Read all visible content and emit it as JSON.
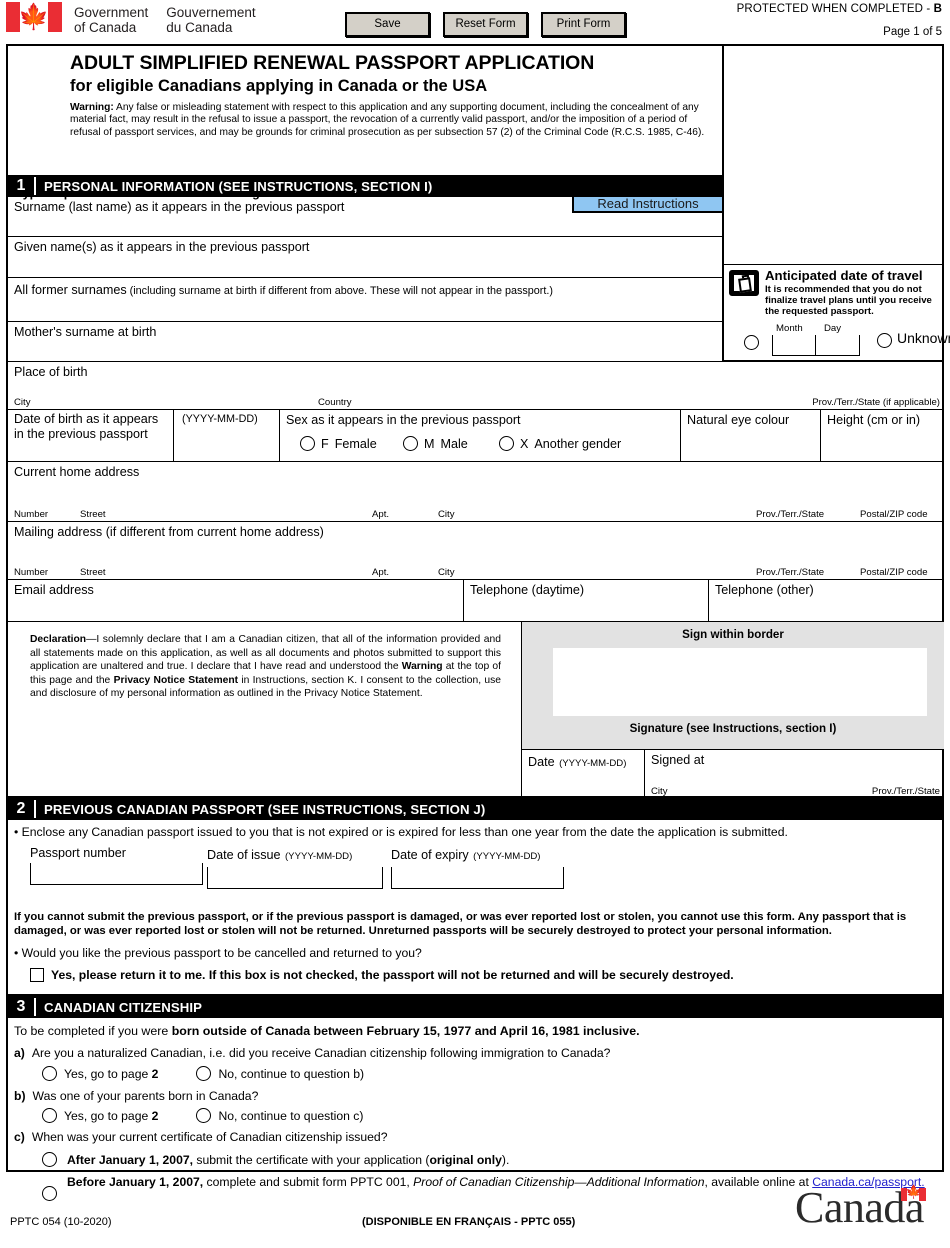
{
  "header": {
    "gov_en_line1": "Government",
    "gov_en_line2": "of Canada",
    "gov_fr_line1": "Gouvernement",
    "gov_fr_line2": "du Canada",
    "flag_icon": "canada-flag-icon",
    "buttons": {
      "save": "Save",
      "reset": "Reset Form",
      "print": "Print Form"
    },
    "protected_prefix": "PROTECTED WHEN COMPLETED - ",
    "protected_level": "B",
    "page_number": "Page 1 of 5"
  },
  "title": {
    "line1": "ADULT SIMPLIFIED RENEWAL PASSPORT APPLICATION",
    "line2": "for eligible Canadians applying in Canada or the USA",
    "warning_label": "Warning:",
    "warning_text": " Any false or misleading statement with respect to this application and any supporting document, including the concealment of any material fact, may result in the refusal to issue a passport, the revocation of a currently valid passport, and/or the imposition of a period of refusal of passport services, and may be grounds for criminal prosecution as per subsection 57 (2) of the Criminal Code (R.C.S. 1985, C-46).",
    "type_instruction": "Type or print in CAPITAL LETTERS using black or dark blue ink.",
    "read_instructions": "Read Instructions"
  },
  "travel": {
    "icon": "suitcase-icon",
    "title": "Anticipated date of travel",
    "note": "It is recommended that you do not finalize travel plans until you receive the requested passport.",
    "month_label": "Month",
    "day_label": "Day",
    "unknown_label": "Unknown"
  },
  "section1": {
    "number": "1",
    "title": "PERSONAL INFORMATION (SEE INSTRUCTIONS, SECTION I)",
    "surname": "Surname (last name) as it appears in the previous passport",
    "given_names": "Given name(s) as it appears in the previous passport",
    "former_surnames_bold": "All former surnames",
    "former_surnames_rest": " (including surname at birth if different from above. These will not appear in the passport.)",
    "mothers_surname": "Mother's surname at birth",
    "place_of_birth": "Place of birth",
    "city": "City",
    "country": "Country",
    "prov_state_applicable": "Prov./Terr./State (if applicable)",
    "dob_label": "Date of birth as it appears in the previous passport",
    "dob_format": "(YYYY-MM-DD)",
    "sex_label": "Sex as it appears in the previous passport",
    "sex_options": [
      {
        "code": "F",
        "label": "Female"
      },
      {
        "code": "M",
        "label": "Male"
      },
      {
        "code": "X",
        "label": "Another gender"
      }
    ],
    "eye_colour": "Natural eye colour",
    "height": "Height (cm or in)",
    "current_home_address": "Current home address",
    "mailing_address": "Mailing address (if different from current home address)",
    "addr_number": "Number",
    "addr_street": "Street",
    "addr_apt": "Apt.",
    "addr_city": "City",
    "addr_prov": "Prov./Terr./State",
    "addr_postal": "Postal/ZIP code",
    "email": "Email address",
    "phone_daytime": "Telephone (daytime)",
    "phone_other": "Telephone (other)",
    "declaration_label": "Declaration",
    "declaration_text_1": "—I solemnly declare that I am a Canadian citizen, that all of the information provided and all statements made on this application, as well as all documents and photos submitted to support this application are unaltered and true. I declare that I have read and understood the ",
    "declaration_warning": "Warning",
    "declaration_text_2": " at the top of this page and the ",
    "declaration_privacy": "Privacy Notice Statement",
    "declaration_text_3": " in Instructions, section K. I consent to the collection, use and disclosure of my personal information as outlined in the Privacy Notice Statement.",
    "sign_within_border": "Sign within border",
    "signature_caption": "Signature (see Instructions, section I)",
    "date_label": "Date",
    "date_format": "(YYYY-MM-DD)",
    "signed_at": "Signed at",
    "signed_city": "City",
    "signed_prov": "Prov./Terr./State"
  },
  "section2": {
    "number": "2",
    "title": "PREVIOUS CANADIAN PASSPORT (SEE INSTRUCTIONS, SECTION J)",
    "bullet1": "• Enclose any Canadian passport issued to you that is not expired or is expired for less than one year from the date the application is submitted.",
    "passport_number": "Passport number",
    "date_of_issue": "Date of issue",
    "date_of_issue_format": "(YYYY-MM-DD)",
    "date_of_expiry": "Date of expiry",
    "date_of_expiry_format": "(YYYY-MM-DD)",
    "notice": "If you cannot submit the previous passport, or if the previous passport is damaged, or was ever reported lost or stolen, you cannot use this form. Any passport that is damaged, or was ever reported lost or stolen will not be returned. Unreturned passports will be securely destroyed to protect your personal information.",
    "bullet2": "• Would you like the previous passport to be cancelled and returned to you?",
    "checkbox_label": "Yes, please return it to me. If this box is not checked, the passport will not be returned and will be securely destroyed."
  },
  "section3": {
    "number": "3",
    "title": "CANADIAN CITIZENSHIP",
    "intro_plain": "To be completed if you were ",
    "intro_bold": "born outside of Canada between February 15, 1977 and April 16, 1981 inclusive.",
    "qa_letter": "a)",
    "qa_text": "Are you a naturalized Canadian, i.e. did you receive Canadian citizenship following immigration to Canada?",
    "qa_yes_pre": "Yes, go to page ",
    "qa_yes_bold": "2",
    "qa_no": "No, continue to question b)",
    "qb_letter": "b)",
    "qb_text": "Was one of your parents born in Canada?",
    "qb_yes_pre": "Yes, go to page ",
    "qb_yes_bold": "2",
    "qb_no": "No, continue to question c)",
    "qc_letter": "c)",
    "qc_text": "When was your current certificate of Canadian citizenship issued?",
    "opt_after_bold": "After January 1, 2007,",
    "opt_after_rest": " submit the certificate with your application (",
    "opt_after_bold2": "original only",
    "opt_after_end": ").",
    "opt_before_bold": "Before January 1, 2007,",
    "opt_before_rest": " complete and submit form PPTC 001, ",
    "opt_before_italic": "Proof of Canadian Citizenship—Additional Information",
    "opt_before_rest2": ", available online at ",
    "opt_before_link": "Canada.ca/passport."
  },
  "footer": {
    "form_code": "PPTC 054 (10-2020)",
    "french_note": "(DISPONIBLE EN FRANÇAIS - PPTC 055)",
    "wordmark": "Canada",
    "wordmark_flag": "canada-flag-icon"
  }
}
